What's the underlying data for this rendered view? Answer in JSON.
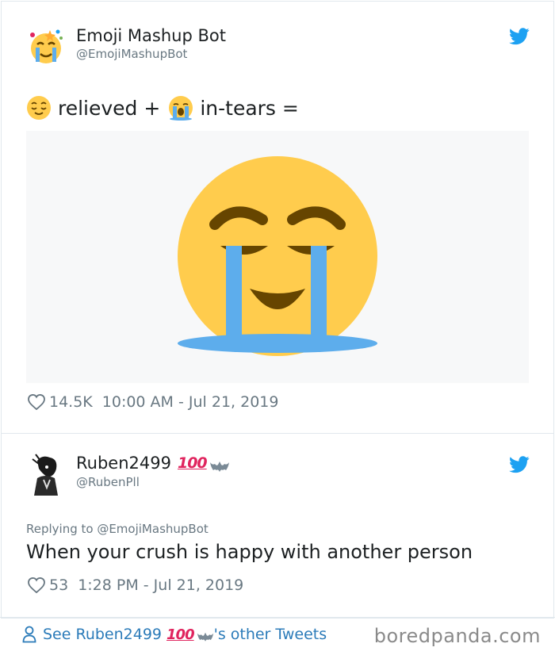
{
  "tweet1": {
    "name": "Emoji Mashup Bot",
    "handle": "@EmojiMashupBot",
    "icon": "twitter-bird-icon",
    "text_part1": "relieved +",
    "text_part2": "in-tears =",
    "emoji1": "relieved-face-icon",
    "emoji2": "loudly-crying-face-icon",
    "media": "relieved-crying-mashup-emoji",
    "likes": "14.5K",
    "timestamp": "10:00 AM - Jul 21, 2019"
  },
  "tweet2": {
    "name": "Ruben2499",
    "name_badge": "100",
    "handle": "@RubenPll",
    "reply_to": "Replying to @EmojiMashupBot",
    "text": "When your crush is happy with another person",
    "likes": "53",
    "timestamp": "1:28 PM - Jul 21, 2019"
  },
  "footer": {
    "see_prefix": "See Ruben2499",
    "badge": "100",
    "see_suffix": "'s other Tweets",
    "watermark": "boredpanda.com"
  },
  "colors": {
    "twitter_blue": "#1da1f2",
    "link_blue": "#2b7bb9",
    "emoji_yellow": "#ffcc4d",
    "tear_blue": "#5dadec",
    "emoji_brown": "#664500",
    "hundred_red": "#e0245e"
  }
}
